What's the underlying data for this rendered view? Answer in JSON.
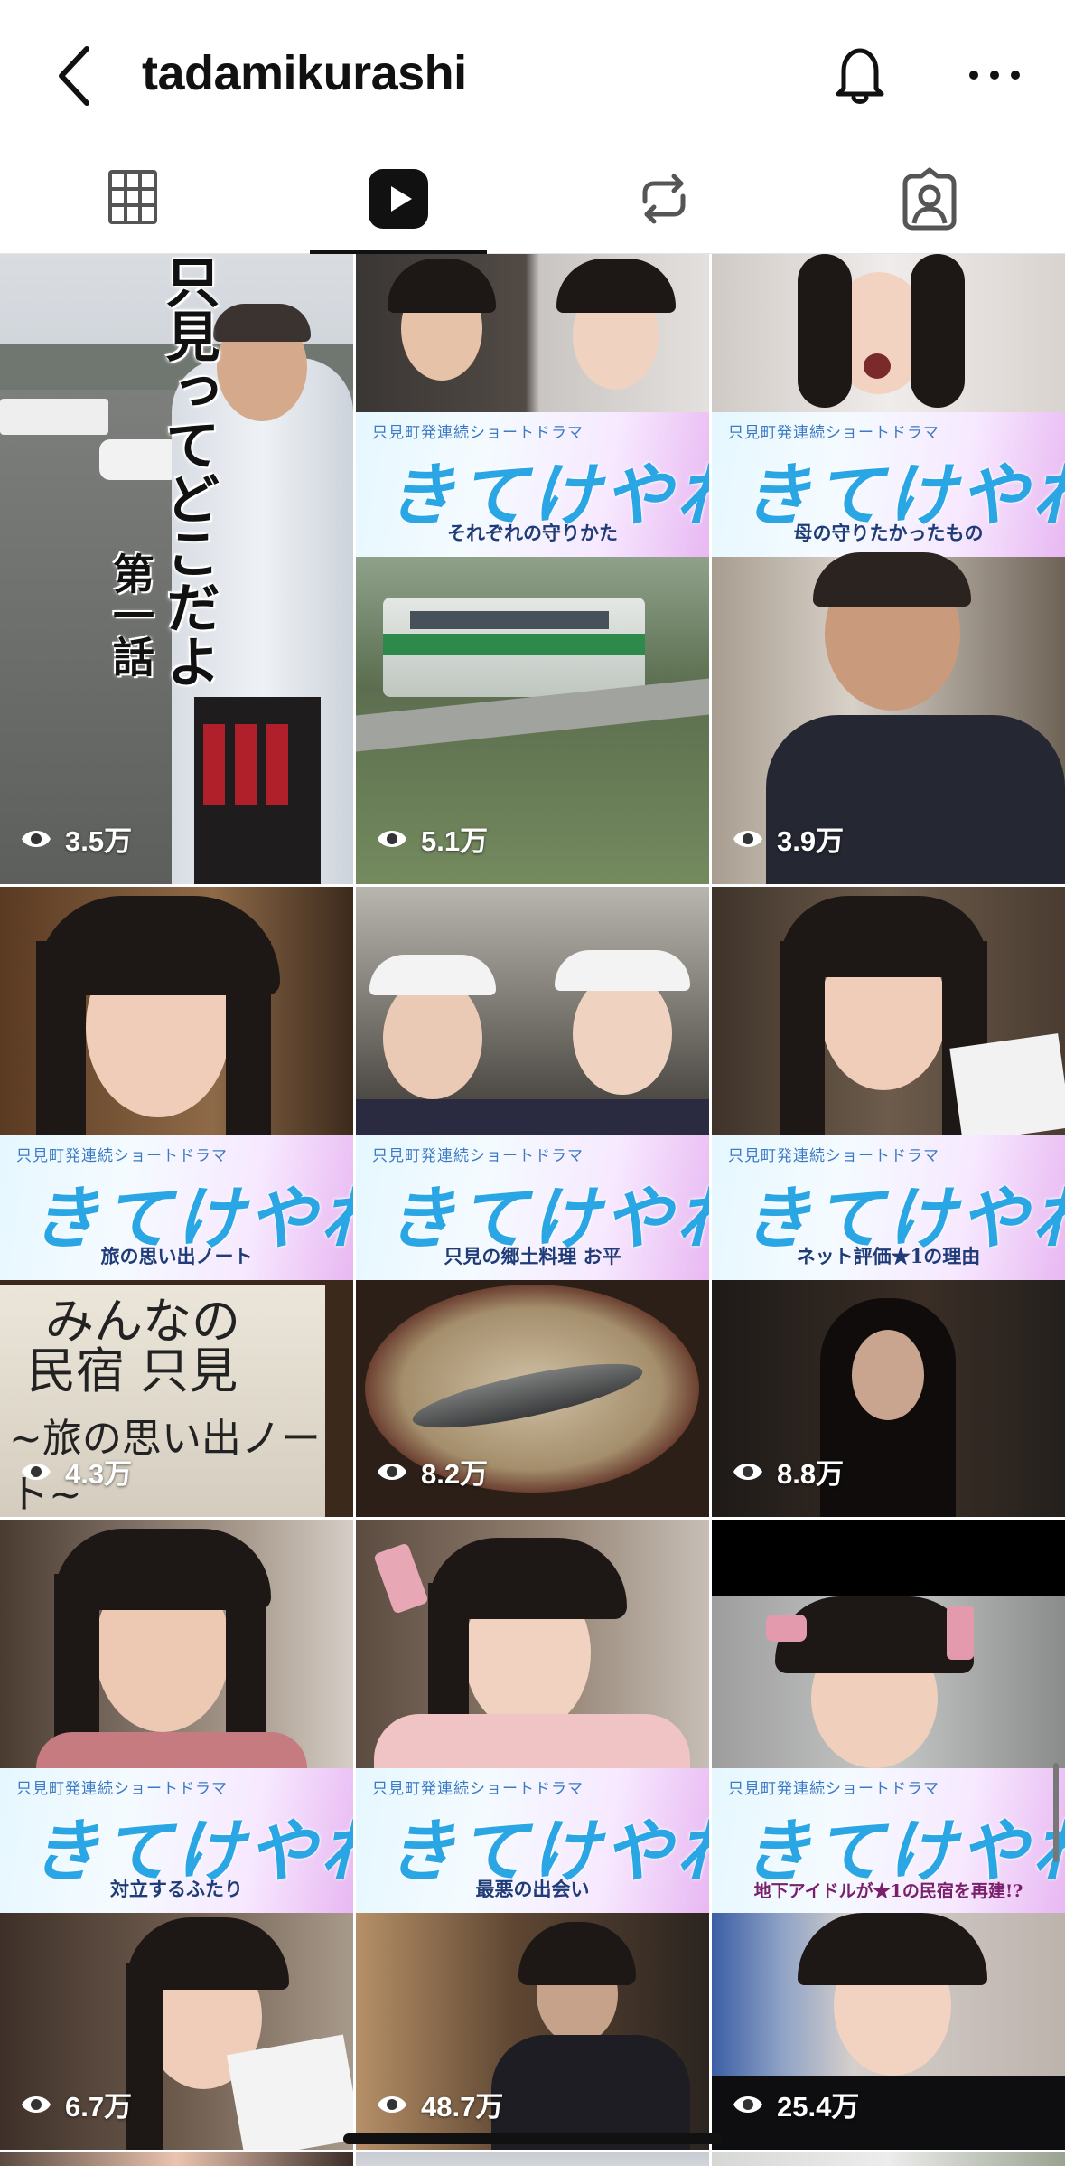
{
  "header": {
    "username": "tadamikurashi"
  },
  "tabs": [
    {
      "name": "posts-grid",
      "icon": "grid-icon",
      "active": false
    },
    {
      "name": "reels",
      "icon": "reels-icon",
      "active": true
    },
    {
      "name": "reposts",
      "icon": "repost-icon",
      "active": false
    },
    {
      "name": "tagged",
      "icon": "tagged-user-icon",
      "active": false
    }
  ],
  "grid": {
    "items": [
      {
        "views": "3.5万",
        "overlay_text": "只見ってどこだよ",
        "overlay_text2": "第一話"
      },
      {
        "views": "5.1万",
        "banner_top": "只見町発連続ショートドラマ",
        "banner_logo": "きてけやれ!",
        "banner_sub": "それぞれの守りかた"
      },
      {
        "views": "3.9万",
        "banner_top": "只見町発連続ショートドラマ",
        "banner_logo": "きてけやれ!",
        "banner_sub": "母の守りたかったもの"
      },
      {
        "views": "4.3万",
        "banner_top": "只見町発連続ショートドラマ",
        "banner_logo": "きてけやれ!",
        "banner_sub": "旅の思い出ノート",
        "note_text1": "みんなの",
        "note_text2": "民宿 只見",
        "note_text3": "~旅の思い出ノート~"
      },
      {
        "views": "8.2万",
        "banner_top": "只見町発連続ショートドラマ",
        "banner_logo": "きてけやれ!",
        "banner_sub": "只見の郷土料理 お平"
      },
      {
        "views": "8.8万",
        "banner_top": "只見町発連続ショートドラマ",
        "banner_logo": "きてけやれ!",
        "banner_sub": "ネット評価★1の理由"
      },
      {
        "views": "6.7万",
        "banner_top": "只見町発連続ショートドラマ",
        "banner_logo": "きてけやれ!",
        "banner_sub": "対立するふたり"
      },
      {
        "views": "48.7万",
        "banner_top": "只見町発連続ショートドラマ",
        "banner_logo": "きてけやれ!",
        "banner_sub": "最悪の出会い"
      },
      {
        "views": "25.4万",
        "banner_top": "只見町発連続ショートドラマ",
        "banner_logo": "きてけやれ!",
        "banner_sub": "地下アイドルが★1の民宿を再建!?"
      }
    ]
  },
  "colors": {
    "banner_logo": "#2aa6e4",
    "banner_sub": "#1f3c78",
    "active_tab_indicator": "#111111"
  }
}
